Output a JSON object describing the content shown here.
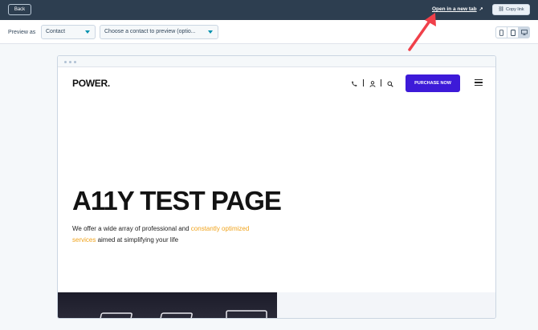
{
  "toolbar": {
    "back_label": "Back",
    "open_new_tab_label": "Open in a new tab",
    "copy_link_label": "Copy link"
  },
  "preview": {
    "preview_as_label": "Preview as",
    "type_select_value": "Contact",
    "contact_select_value": "Choose a contact to preview (optio..."
  },
  "site": {
    "logo": "POWER.",
    "purchase_label": "PURCHASE NOW",
    "hero_title": "A11Y TEST PAGE",
    "hero_text_1": "We offer a wide array of professional and ",
    "hero_text_highlight": "constantly optimized services",
    "hero_text_2": " aimed at simplifying your life"
  },
  "colors": {
    "topbar": "#2d3e50",
    "purchase_button": "#3d1ad8",
    "highlight_text": "#f0a31c",
    "annotation_arrow": "#f0404a"
  }
}
